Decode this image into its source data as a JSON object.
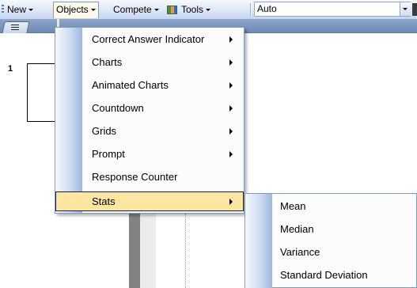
{
  "toolbar": {
    "new_label": "New",
    "objects_label": "Objects",
    "compete_label": "Compete",
    "tools_label": "Tools",
    "combo_value": "Auto"
  },
  "slides": {
    "number": "1"
  },
  "objects_menu": {
    "items": [
      {
        "label": "Correct Answer Indicator",
        "has_submenu": true
      },
      {
        "label": "Charts",
        "has_submenu": true
      },
      {
        "label": "Animated Charts",
        "has_submenu": true
      },
      {
        "label": "Countdown",
        "has_submenu": true
      },
      {
        "label": "Grids",
        "has_submenu": true
      },
      {
        "label": "Prompt",
        "has_submenu": true
      },
      {
        "label": "Response Counter",
        "has_submenu": false
      },
      {
        "label": "Stats",
        "has_submenu": true,
        "highlighted": true
      }
    ]
  },
  "stats_submenu": {
    "items": [
      {
        "label": "Mean"
      },
      {
        "label": "Median"
      },
      {
        "label": "Variance"
      },
      {
        "label": "Standard Deviation"
      }
    ]
  },
  "colors": {
    "highlight": "#fde5a2",
    "menu_border": "#7f9db9",
    "toolbar_bottom": "#c4d6ef"
  }
}
